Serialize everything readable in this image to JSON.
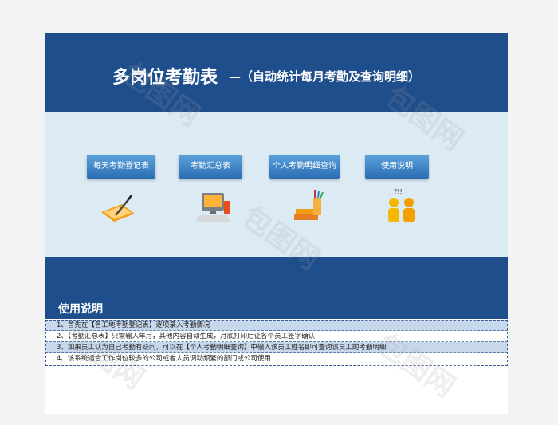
{
  "header": {
    "title": "多岗位考勤表",
    "subtitle": "—（自动统计每月考勤及查询明细）"
  },
  "buttons": [
    {
      "label": "每天考勤登记表",
      "icon": "pen-paper-icon"
    },
    {
      "label": "考勤汇总表",
      "icon": "computer-icon"
    },
    {
      "label": "个人考勤明细查询",
      "icon": "books-pencils-icon"
    },
    {
      "label": "使用说明",
      "icon": "people-question-icon"
    }
  ],
  "usage": {
    "title": "使用说明",
    "rows": [
      "1、首先在【各工地考勤登记表】逐项录入考勤情况",
      "2、【考勤汇总表】只需输入年月，其他内容自动生成，月底打印后让各个员工签字确认",
      "3、如果员工认为自己考勤有疑问，可以在【个人考勤明细查询】中输入该员工姓名即可查询该员工的考勤明细",
      "4、该系统适合工作岗位较多的公司或者人员调动频繁的部门或公司使用"
    ]
  },
  "watermark": {
    "text": "包图网"
  },
  "colors": {
    "header_bg": "#1f4e8c",
    "content_bg": "#dceaf3",
    "button_bg": "#3d86c8",
    "row_alt_bg": "#c8d8ec"
  }
}
